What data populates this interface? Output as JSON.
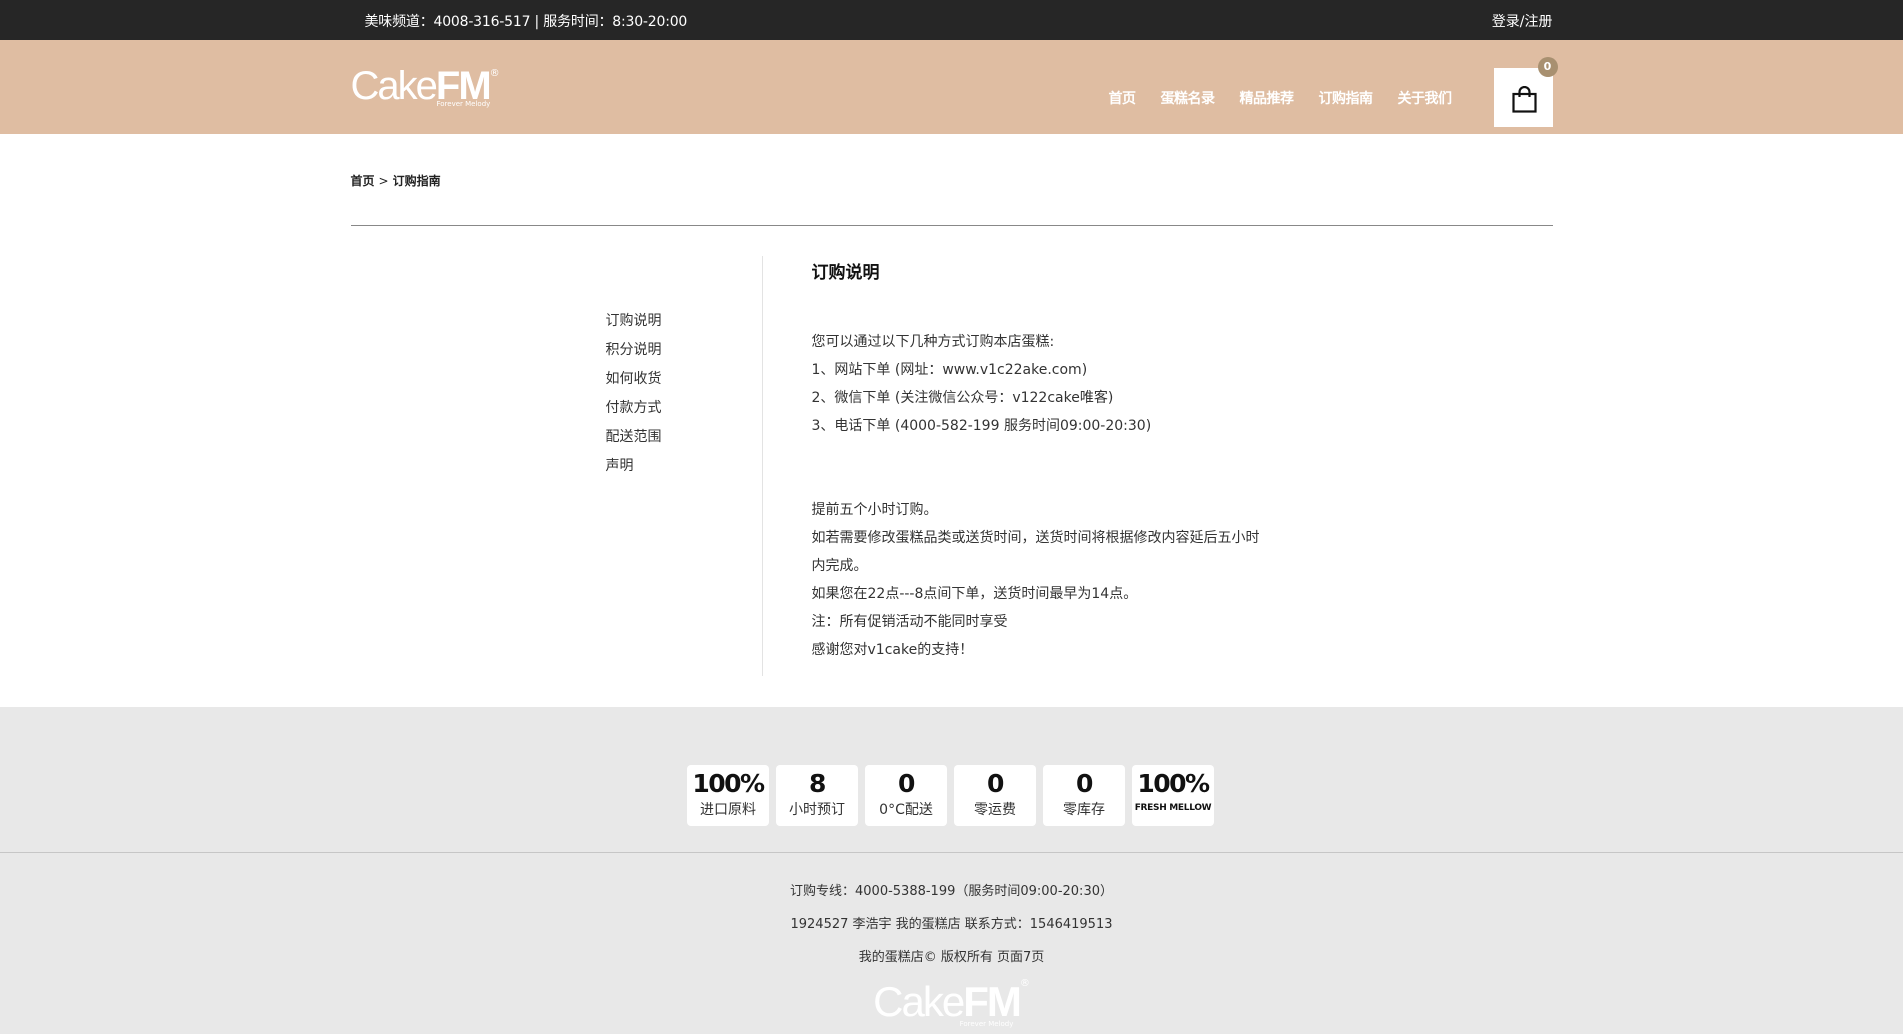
{
  "topbar": {
    "hotline": "美味频道：4008-316-517 | 服务时间：8:30-20:00",
    "login": "登录/注册"
  },
  "header": {
    "logo": {
      "light": "Cake",
      "bold": "FM",
      "reg": "®",
      "tag": "Forever Melody"
    },
    "nav": [
      "首页",
      "蛋糕名录",
      "精品推荐",
      "订购指南",
      "关于我们"
    ],
    "cart_count": "0"
  },
  "breadcrumb": {
    "home": "首页",
    "sep": ">",
    "current": "订购指南"
  },
  "sidemenu": [
    "订购说明",
    "积分说明",
    "如何收货",
    "付款方式",
    "配送范围",
    "声明"
  ],
  "article": {
    "title": "订购说明",
    "block1": [
      "您可以通过以下几种方式订购本店蛋糕:",
      "1、网站下单 (网址：www.v1c22ake.com)",
      "2、微信下单 (关注微信公众号：v122cake唯客)",
      "3、电话下单 (4000-582-199 服务时间09:00-20:30)"
    ],
    "block2": [
      "提前五个小时订购。",
      "如若需要修改蛋糕品类或送货时间，送货时间将根据修改内容延后五小时内完成。",
      "如果您在22点---8点间下单，送货时间最早为14点。",
      "注：所有促销活动不能同时享受",
      "感谢您对v1cake的支持！"
    ]
  },
  "features": [
    {
      "big": "100%",
      "small": "进口原料"
    },
    {
      "big": "8",
      "small": "小时预订"
    },
    {
      "big": "0",
      "small": "0°C配送"
    },
    {
      "big": "0",
      "small": "零运费"
    },
    {
      "big": "0",
      "small": "零库存"
    },
    {
      "big": "100%",
      "tiny": "FRESH MELLOW"
    }
  ],
  "footer": {
    "line1": "订购专线：4000-5388-199（服务时间09:00-20:30）",
    "line2": "1924527 李浩宇 我的蛋糕店 联系方式：1546419513",
    "line3": "我的蛋糕店© 版权所有 页面7页"
  },
  "colors": {
    "topbar": "#262626",
    "header": "#dfbda2",
    "badge": "#a89070",
    "footer": "#e8e8e8"
  }
}
